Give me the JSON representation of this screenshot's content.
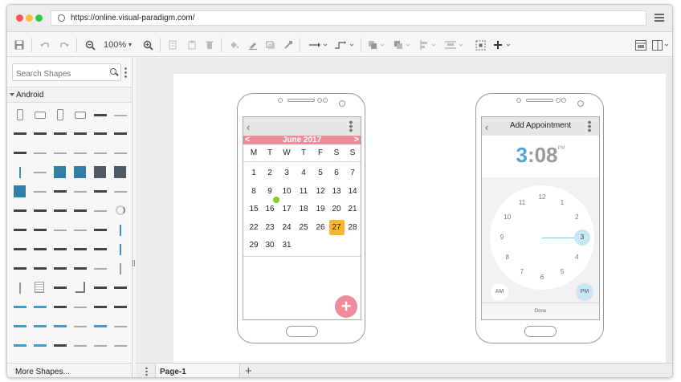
{
  "browser": {
    "url": "https://online.visual-paradigm.com/"
  },
  "toolbar": {
    "zoom_level": "100%"
  },
  "sidebar": {
    "search_placeholder": "Search Shapes",
    "section_label": "Android",
    "more_shapes_label": "More Shapes..."
  },
  "bottombar": {
    "page_tab_label": "Page-1",
    "add_page_glyph": "+"
  },
  "calendar_screen": {
    "back_glyph": "‹",
    "month_label": "June 2017",
    "prev_glyph": "<",
    "next_glyph": ">",
    "weekdays": [
      "M",
      "T",
      "W",
      "T",
      "F",
      "S",
      "S"
    ],
    "weeks": [
      [
        "1",
        "2",
        "3",
        "4",
        "5",
        "6",
        "7"
      ],
      [
        "8",
        "9",
        "10",
        "11",
        "12",
        "13",
        "14"
      ],
      [
        "15",
        "16",
        "17",
        "18",
        "19",
        "20",
        "21"
      ],
      [
        "22",
        "23",
        "24",
        "25",
        "26",
        "27",
        "28"
      ],
      [
        "29",
        "30",
        "31",
        "",
        "",
        "",
        ""
      ]
    ],
    "selected_day": "27",
    "today_marker_day": "16",
    "fab_glyph": "+",
    "accent_color": "#f08b9b",
    "selected_color": "#f5b730",
    "today_color": "#7ed321"
  },
  "appointment_screen": {
    "back_glyph": "‹",
    "title": "Add Appointment",
    "time_hour": "3",
    "time_minutes": ":08",
    "time_period": "PM",
    "clock_numbers": [
      "12",
      "1",
      "2",
      "3",
      "4",
      "5",
      "6",
      "7",
      "8",
      "9",
      "10",
      "11"
    ],
    "selected_hour": "3",
    "am_label": "AM",
    "pm_label": "PM",
    "done_label": "Done",
    "accent_color": "#4aa5d8"
  }
}
